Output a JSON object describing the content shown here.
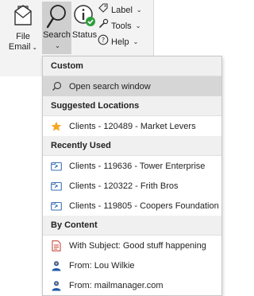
{
  "ribbon": {
    "file_email": {
      "line1": "File",
      "line2": "Email",
      "caret": "⌄"
    },
    "search": {
      "line1": "Search",
      "caret": "⌄"
    },
    "status": {
      "label": "Status"
    },
    "label": {
      "text": "Label",
      "caret": "⌄"
    },
    "tools": {
      "text": "Tools",
      "caret": "⌄"
    },
    "help": {
      "text": "Help",
      "caret": "⌄"
    }
  },
  "menu": {
    "custom_header": "Custom",
    "open_search": "Open search window",
    "suggested_header": "Suggested Locations",
    "suggested": [
      {
        "label": "Clients - 120489 - Market Levers",
        "icon": "star-icon"
      }
    ],
    "recent_header": "Recently Used",
    "recent": [
      {
        "label": "Clients - 119636 - Tower Enterprise",
        "icon": "folder-link-icon"
      },
      {
        "label": "Clients - 120322 - Frith Bros",
        "icon": "folder-link-icon"
      },
      {
        "label": "Clients - 119805 - Coopers Foundation",
        "icon": "folder-link-icon"
      }
    ],
    "content_header": "By Content",
    "content": [
      {
        "label": "With Subject: Good stuff happening",
        "icon": "document-icon"
      },
      {
        "label": "From: Lou Wilkie",
        "icon": "person-icon"
      },
      {
        "label": "From: mailmanager.com",
        "icon": "person-icon"
      }
    ]
  },
  "colors": {
    "star": "#f5a623",
    "check": "#2e9e3e",
    "folder": "#3b6fb6",
    "person": "#1f5aa8",
    "highlight": "#d6d6d6"
  }
}
